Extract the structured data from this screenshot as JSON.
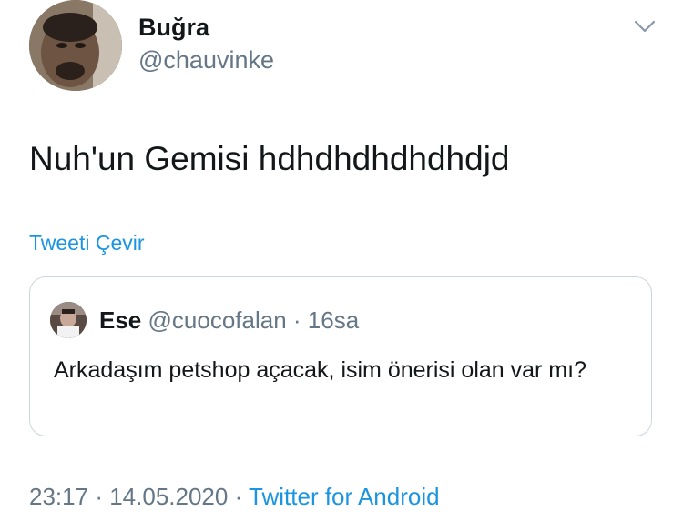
{
  "author": {
    "name": "Buğra",
    "handle": "@chauvinke"
  },
  "tweet": {
    "text": "Nuh'un Gemisi hdhdhdhdhdhdjd",
    "translate_label": "Tweeti Çevir"
  },
  "quoted": {
    "name": "Ese",
    "handle": "@cuocofalan",
    "separator": "·",
    "time": "16sa",
    "text": "Arkadaşım petshop açacak, isim önerisi olan var mı?"
  },
  "meta": {
    "time": "23:17",
    "separator1": "·",
    "date": "14.05.2020",
    "separator2": "·",
    "source": "Twitter for Android"
  },
  "colors": {
    "link": "#1b95e0",
    "secondary_text": "#657786",
    "primary_text": "#14171a",
    "border": "#ccd6dd"
  },
  "icons": {
    "menu": "chevron-down-icon"
  }
}
